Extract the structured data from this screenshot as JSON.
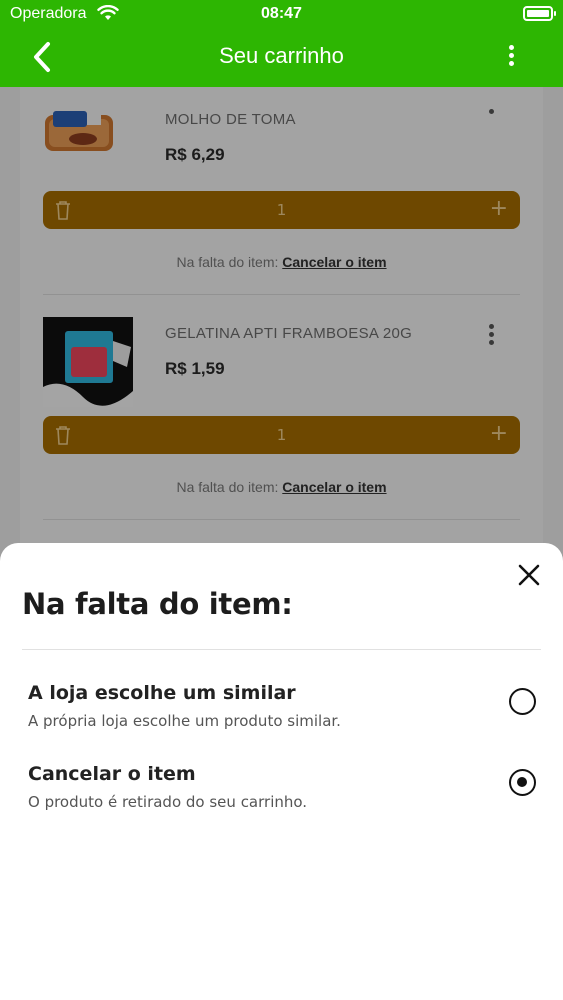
{
  "status_bar": {
    "carrier": "Operadora",
    "time": "08:47"
  },
  "header": {
    "title": "Seu carrinho"
  },
  "cart": {
    "items": [
      {
        "name": "MOLHO DE TOMA",
        "price": "R$ 6,29",
        "quantity": "1",
        "shortage_label": "Na falta do item:",
        "shortage_action": "Cancelar o item"
      },
      {
        "name": "GELATINA APTI FRAMBOESA 20G",
        "price": "R$ 1,59",
        "quantity": "1",
        "shortage_label": "Na falta do item:",
        "shortage_action": "Cancelar o item"
      }
    ]
  },
  "sheet": {
    "title": "Na falta do item:",
    "options": [
      {
        "title": "A loja escolhe um similar",
        "description": "A própria loja escolhe um produto similar.",
        "selected": false
      },
      {
        "title": "Cancelar o item",
        "description": "O produto é retirado do seu carrinho.",
        "selected": true
      }
    ]
  },
  "colors": {
    "header_green": "#2db602",
    "quantity_bar": "#a26b00"
  }
}
